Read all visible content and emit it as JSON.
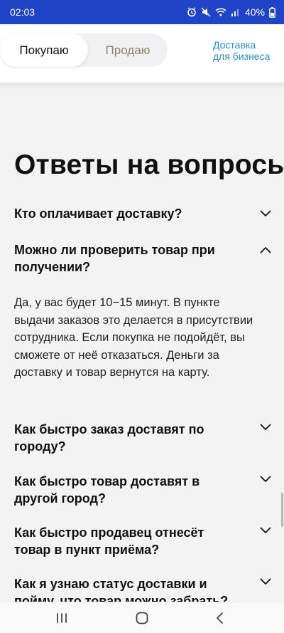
{
  "status_bar": {
    "time": "02:03",
    "battery": "40%"
  },
  "header": {
    "tabs": [
      {
        "label": "Покупаю",
        "active": true
      },
      {
        "label": "Продаю",
        "active": false
      }
    ],
    "business_link": {
      "line1": "Доставка",
      "line2": "для бизнеса"
    }
  },
  "faq": {
    "title": "Ответы на вопросы",
    "items": [
      {
        "question": "Кто оплачивает доставку?",
        "expanded": false
      },
      {
        "question": "Можно ли проверить товар при получении?",
        "expanded": true,
        "answer": "Да, у вас будет 10−15 минут. В пункте выдачи заказов это делается в присутствии сотрудника. Если покупка не подойдёт, вы сможете от неё отказаться. Деньги за доставку и товар вернутся на карту."
      },
      {
        "question": "Как быстро заказ доставят по городу?",
        "expanded": false
      },
      {
        "question": "Как быстро товар доставят в другой город?",
        "expanded": false
      },
      {
        "question": "Как быстро продавец отнесёт товар в пункт приёма?",
        "expanded": false
      },
      {
        "question": "Как я узнаю статус доставки и пойму, что товар можно забрать?",
        "expanded": false
      }
    ]
  },
  "colors": {
    "status_bar": "#1f44c8",
    "link": "#2a8cc9",
    "inactive_tab": "#8c8263",
    "background": "#f3f3f4"
  },
  "nav_icons": [
    "recent-apps-icon",
    "home-icon",
    "back-icon"
  ]
}
